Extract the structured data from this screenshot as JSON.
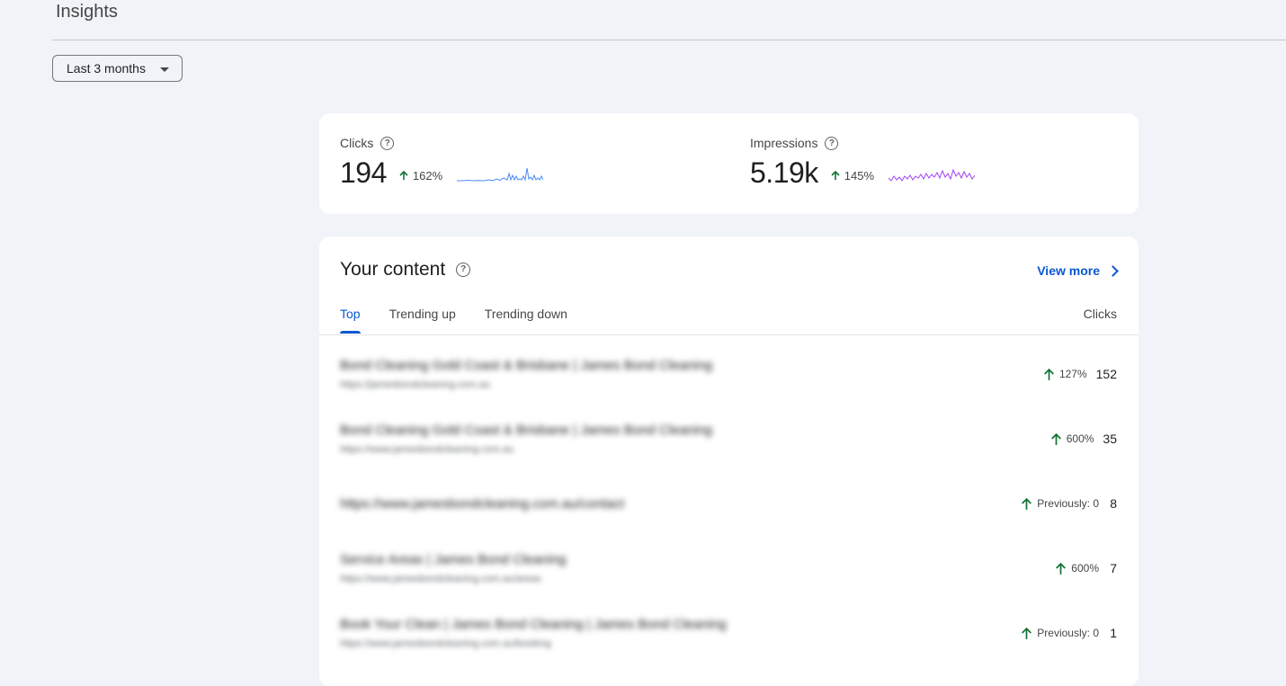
{
  "page": {
    "title": "Insights",
    "date_range": "Last 3 months"
  },
  "stats": {
    "clicks": {
      "label": "Clicks",
      "value": "194",
      "change": "162%",
      "spark_color": "#4c8bf5"
    },
    "impressions": {
      "label": "Impressions",
      "value": "5.19k",
      "change": "145%",
      "spark_color": "#a142f4"
    }
  },
  "content": {
    "title": "Your content",
    "view_more": "View more",
    "tabs": [
      "Top",
      "Trending up",
      "Trending down"
    ],
    "active_tab": "Top",
    "column_header": "Clicks",
    "rows": [
      {
        "title": "Bond Cleaning Gold Coast & Brisbane | James Bond Cleaning",
        "url": "https://jamesbondcleaning.com.au",
        "change": "127%",
        "clicks": "152"
      },
      {
        "title": "Bond Cleaning Gold Coast & Brisbane | James Bond Cleaning",
        "url": "https://www.jamesbondcleaning.com.au",
        "change": "600%",
        "clicks": "35"
      },
      {
        "title": "https://www.jamesbondcleaning.com.au/contact",
        "url": "",
        "change": "Previously: 0",
        "clicks": "8"
      },
      {
        "title": "Service Areas | James Bond Cleaning",
        "url": "https://www.jamesbondcleaning.com.au/areas",
        "change": "600%",
        "clicks": "7"
      },
      {
        "title": "Book Your Clean | James Bond Cleaning | James Bond Cleaning",
        "url": "https://www.jamesbondcleaning.com.au/booking",
        "change": "Previously: 0",
        "clicks": "1"
      }
    ]
  },
  "colors": {
    "accent": "#0b57d0",
    "trend_up": "#137333",
    "background": "#f0f4f9",
    "card": "#ffffff"
  }
}
